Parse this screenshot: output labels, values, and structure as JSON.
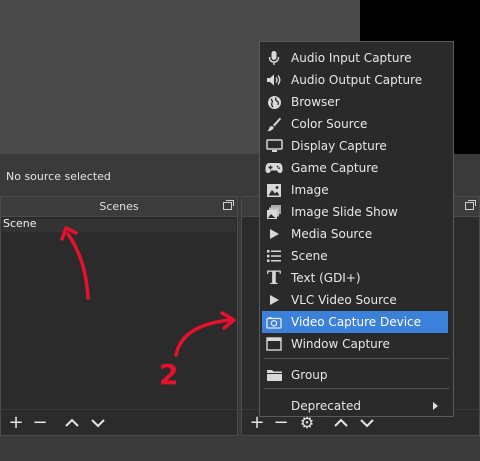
{
  "status": {
    "source_text": "No source selected"
  },
  "scenes_dock": {
    "title": "Scenes",
    "scene": "Scene",
    "toolbar": {
      "add": "+",
      "remove": "−",
      "up": "⌃",
      "down": "⌄"
    }
  },
  "sources_dock": {
    "toolbar": {
      "add": "+",
      "remove": "−",
      "settings": "⚙",
      "up": "⌃",
      "down": "⌄"
    }
  },
  "menu": {
    "items": [
      {
        "label": "Audio Input Capture",
        "icon": "microphone-icon"
      },
      {
        "label": "Audio Output Capture",
        "icon": "speaker-icon"
      },
      {
        "label": "Browser",
        "icon": "globe-icon"
      },
      {
        "label": "Color Source",
        "icon": "brush-icon"
      },
      {
        "label": "Display Capture",
        "icon": "monitor-icon"
      },
      {
        "label": "Game Capture",
        "icon": "gamepad-icon"
      },
      {
        "label": "Image",
        "icon": "image-icon"
      },
      {
        "label": "Image Slide Show",
        "icon": "slideshow-icon"
      },
      {
        "label": "Media Source",
        "icon": "play-icon"
      },
      {
        "label": "Scene",
        "icon": "list-icon"
      },
      {
        "label": "Text (GDI+)",
        "icon": "text-icon"
      },
      {
        "label": "VLC Video Source",
        "icon": "play-icon"
      },
      {
        "label": "Video Capture Device",
        "icon": "camera-icon",
        "selected": true
      },
      {
        "label": "Window Capture",
        "icon": "window-icon"
      },
      {
        "label": "Group",
        "icon": "folder-icon"
      },
      {
        "label": "Deprecated",
        "icon": "",
        "submenu": true
      }
    ]
  },
  "annotations": {
    "number_label": "2",
    "color": "#e8112d"
  },
  "colors": {
    "selection": "#3b80d9",
    "annotation": "#e8112d"
  }
}
